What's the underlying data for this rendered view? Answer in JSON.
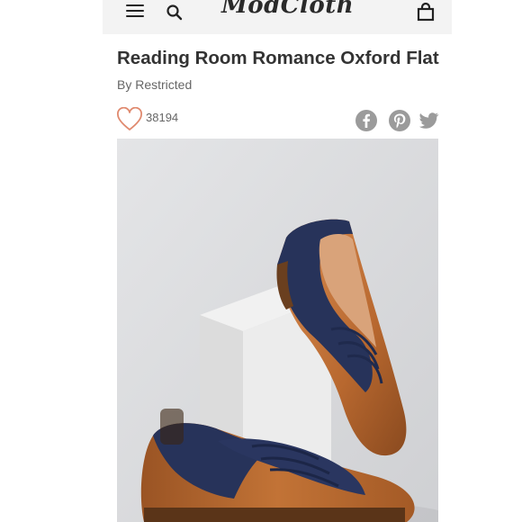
{
  "header": {
    "logo": "ModCloth"
  },
  "product": {
    "title": "Reading Room Romance Oxford Flat",
    "brand": "By Restricted",
    "like_count": "38194"
  },
  "colors": {
    "header_bg": "#f3f3f3",
    "heart": "#e08a6f",
    "share_icons": "#9b9b9b"
  },
  "icons": [
    "menu-icon",
    "search-icon",
    "bag-icon",
    "heart-icon",
    "facebook-icon",
    "pinterest-icon",
    "twitter-icon"
  ]
}
